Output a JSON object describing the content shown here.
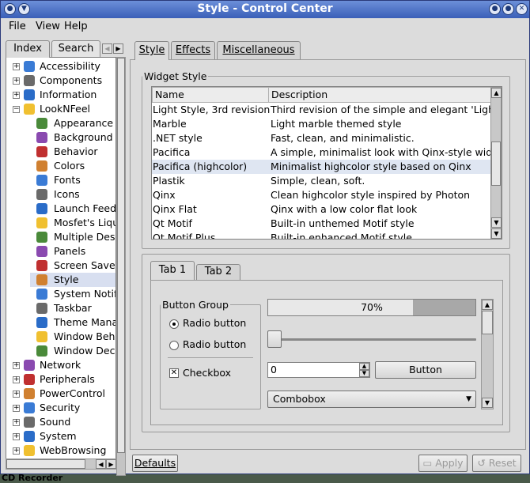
{
  "window": {
    "title": "Style - Control Center"
  },
  "menubar": {
    "file": "File",
    "view": "View",
    "help": "Help"
  },
  "left_tabs": {
    "index": "Index",
    "search": "Search"
  },
  "tree": {
    "top": [
      {
        "label": "Accessibility"
      },
      {
        "label": "Components"
      },
      {
        "label": "Information"
      },
      {
        "label": "LookNFeel"
      }
    ],
    "looknfeel_children": [
      {
        "label": "Appearance"
      },
      {
        "label": "Background"
      },
      {
        "label": "Behavior"
      },
      {
        "label": "Colors"
      },
      {
        "label": "Fonts"
      },
      {
        "label": "Icons"
      },
      {
        "label": "Launch Feedback"
      },
      {
        "label": "Mosfet's Liquid"
      },
      {
        "label": "Multiple Desktops"
      },
      {
        "label": "Panels"
      },
      {
        "label": "Screen Saver"
      },
      {
        "label": "Style"
      },
      {
        "label": "System Notifications"
      },
      {
        "label": "Taskbar"
      },
      {
        "label": "Theme Manager"
      },
      {
        "label": "Window Behavior"
      },
      {
        "label": "Window Decorations"
      }
    ],
    "bottom": [
      {
        "label": "Network"
      },
      {
        "label": "Peripherals"
      },
      {
        "label": "PowerControl"
      },
      {
        "label": "Security"
      },
      {
        "label": "Sound"
      },
      {
        "label": "System"
      },
      {
        "label": "WebBrowsing"
      }
    ]
  },
  "right_tabs": {
    "style": "Style",
    "effects": "Effects",
    "misc": "Miscellaneous"
  },
  "widget_style": {
    "legend": "Widget Style",
    "col_name": "Name",
    "col_desc": "Description",
    "rows": [
      {
        "name": "Light Style, 3rd revision",
        "desc": "Third revision of the simple and elegant 'Light' style"
      },
      {
        "name": "Marble",
        "desc": "Light marble themed style"
      },
      {
        "name": ".NET style",
        "desc": "Fast, clean, and minimalistic."
      },
      {
        "name": "Pacifica",
        "desc": "A simple, minimalist look with Qinx-style widgets"
      },
      {
        "name": "Pacifica (highcolor)",
        "desc": "Minimalist highcolor style based on Qinx"
      },
      {
        "name": "Plastik",
        "desc": "Simple, clean, soft."
      },
      {
        "name": "Qinx",
        "desc": "Clean highcolor style inspired by Photon"
      },
      {
        "name": "Qinx Flat",
        "desc": "Qinx with a low color flat look"
      },
      {
        "name": "Qt Motif",
        "desc": "Built-in unthemed Motif style"
      },
      {
        "name": "Qt Motif Plus",
        "desc": "Built-in enhanced Motif style"
      }
    ],
    "selected_index": 4,
    "selection_color": "#dfe6f2"
  },
  "preview": {
    "tab1": "Tab 1",
    "tab2": "Tab 2",
    "group_legend": "Button Group",
    "radio1": "Radio button",
    "radio2": "Radio button",
    "checkbox": "Checkbox",
    "progress_percent": 70,
    "progress_label": "70%",
    "spin_value": "0",
    "button": "Button",
    "combobox": "Combobox"
  },
  "footer": {
    "defaults": "Defaults",
    "apply": "Apply",
    "reset": "Reset"
  },
  "taskbar_text": "CD Recorder"
}
